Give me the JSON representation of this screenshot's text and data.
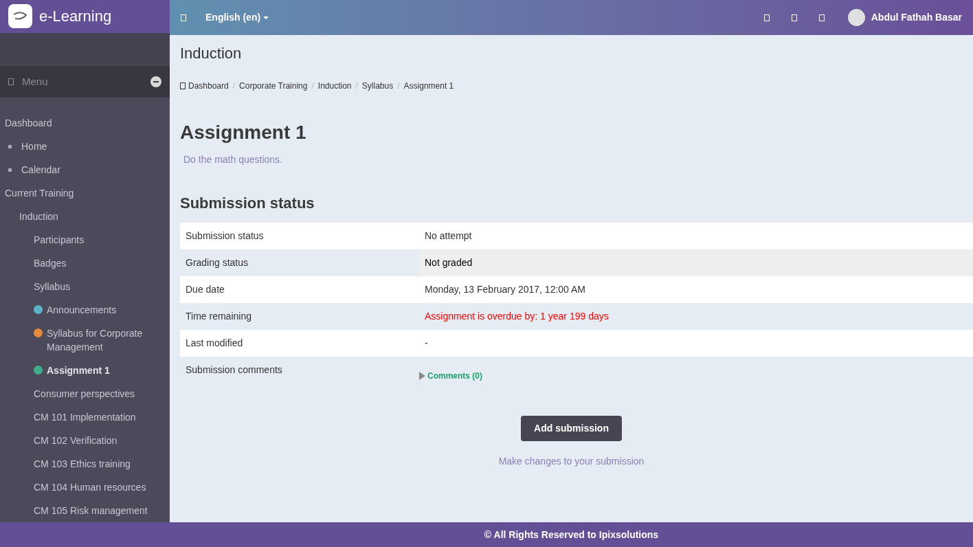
{
  "brand": {
    "name": "e-Learning"
  },
  "topbar": {
    "language": "English (en)",
    "user": "Abdul Fathah Basar"
  },
  "sidebar": {
    "menu_label": "Menu",
    "items": [
      {
        "label": "Dashboard",
        "kind": "plain",
        "selected": false
      },
      {
        "label": "Home",
        "kind": "bullet",
        "selected": false
      },
      {
        "label": "Calendar",
        "kind": "bullet",
        "selected": false
      },
      {
        "label": "Current Training",
        "kind": "plain",
        "selected": false,
        "children": [
          {
            "label": "Induction",
            "kind": "plain",
            "selected": false,
            "children": [
              {
                "label": "Participants",
                "kind": "plain",
                "selected": false
              },
              {
                "label": "Badges",
                "kind": "plain",
                "selected": false
              },
              {
                "label": "Syllabus",
                "kind": "plain",
                "selected": false
              },
              {
                "label": "Announcements",
                "kind": "forum",
                "selected": false
              },
              {
                "label": "Syllabus for Corporate Management",
                "kind": "resource",
                "selected": false
              },
              {
                "label": "Assignment 1",
                "kind": "assignment",
                "selected": true
              },
              {
                "label": "Consumer perspectives",
                "kind": "plain",
                "selected": false
              },
              {
                "label": "CM 101 Implementation",
                "kind": "plain",
                "selected": false
              },
              {
                "label": "CM 102 Verification",
                "kind": "plain",
                "selected": false
              },
              {
                "label": "CM 103 Ethics training",
                "kind": "plain",
                "selected": false
              },
              {
                "label": "CM 104 Human resources",
                "kind": "plain",
                "selected": false
              },
              {
                "label": "CM 105 Risk management",
                "kind": "plain",
                "selected": false
              }
            ]
          }
        ]
      }
    ]
  },
  "page": {
    "course_title": "Induction",
    "breadcrumb": [
      "Dashboard",
      "Corporate Training",
      "Induction",
      "Syllabus",
      "Assignment 1"
    ],
    "breadcrumb_separator": "/",
    "title": "Assignment 1",
    "description": "Do the math questions.",
    "section_title": "Submission status",
    "rows": [
      {
        "label": "Submission status",
        "value": "No attempt",
        "kind": "text"
      },
      {
        "label": "Grading status",
        "value": "Not graded",
        "kind": "highlight"
      },
      {
        "label": "Due date",
        "value": "Monday, 13 February 2017, 12:00 AM",
        "kind": "text"
      },
      {
        "label": "Time remaining",
        "value": "Assignment is overdue by: 1 year 199 days",
        "kind": "overdue"
      },
      {
        "label": "Last modified",
        "value": "-",
        "kind": "text"
      },
      {
        "label": "Submission comments",
        "value": "Comments (0)",
        "kind": "comments"
      }
    ],
    "button": "Add submission",
    "hint": "Make changes to your submission"
  },
  "footer": "© All Rights Reserved to Ipixsolutions"
}
